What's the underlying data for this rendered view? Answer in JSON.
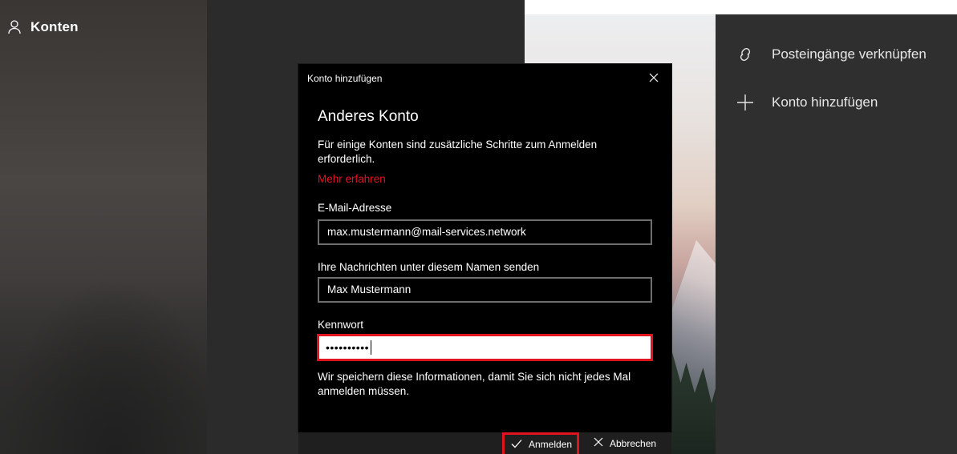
{
  "left": {
    "title": "Konten",
    "icon": "person-icon"
  },
  "right_menu": {
    "items": [
      {
        "label": "Posteingänge verknüpfen",
        "icon": "link-icon"
      },
      {
        "label": "Konto hinzufügen",
        "icon": "plus-icon"
      }
    ]
  },
  "dialog": {
    "window_title": "Konto hinzufügen",
    "heading": "Anderes Konto",
    "description": "Für einige Konten sind zusätzliche Schritte zum Anmelden erforderlich.",
    "learn_more": "Mehr erfahren",
    "email": {
      "label": "E-Mail-Adresse",
      "value": "max.mustermann@mail-services.network"
    },
    "display_name": {
      "label": "Ihre Nachrichten unter diesem Namen senden",
      "value": "Max Mustermann"
    },
    "password": {
      "label": "Kennwort",
      "masked_value": "••••••••••"
    },
    "note": "Wir speichern diese Informationen, damit Sie sich nicht jedes Mal anmelden müssen.",
    "buttons": {
      "sign_in": "Anmelden",
      "cancel": "Abbrechen"
    }
  },
  "colors": {
    "accent_red": "#e0141e",
    "link_red": "#e81123",
    "dialog_bg": "#000000",
    "panel_bg": "#2f2f2f"
  }
}
